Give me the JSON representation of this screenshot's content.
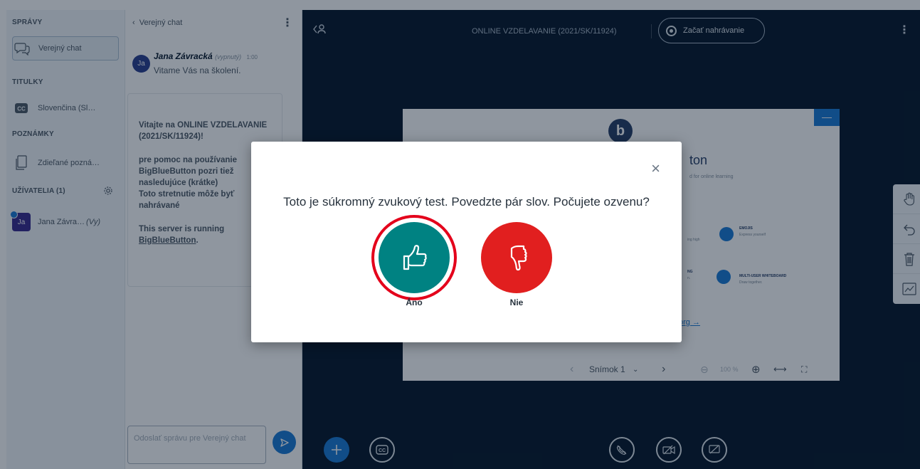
{
  "sidebar": {
    "messages_title": "SPRÁVY",
    "public_chat_label": "Verejný chat",
    "captions_title": "TITULKY",
    "captions_item_label": "Slovenčina (Sl…",
    "notes_title": "POZNÁMKY",
    "notes_item_label": "Zdieľané pozná…",
    "users_title": "UŽÍVATELIA (1)",
    "user_initials": "Ja",
    "user_name": "Jana Závra…",
    "user_you": "(Vy)"
  },
  "chat": {
    "title": "Verejný chat",
    "author_initials": "Ja",
    "author": "Jana Závracká",
    "author_status": "(vypnutý)",
    "time": "1:00",
    "first_message": "Vitame Vás na školení.",
    "welcome_line1": "Vitajte na ",
    "welcome_bold": "ONLINE VZDELAVANIE (2021/SK/11924)",
    "welcome_line1_end": "!",
    "welcome_p2": "pre pomoc na používanie BigBlueButton pozri tiež nasledujúce (krátke)",
    "welcome_p2b": "Toto stretnutie môže byť nahrávané",
    "welcome_p3": "This server is running ",
    "welcome_p3_link": "BigBlueButton",
    "welcome_p3_end": ".",
    "input_placeholder": "Odoslať správu pre Verejný chat"
  },
  "main": {
    "meeting_title": "ONLINE VZDELAVANIE (2021/SK/11924)",
    "record_label": "Začať nahrávanie",
    "slide_title_fragment": "ton",
    "slide_subtitle_fragment": "d for online learning",
    "feature_emojis_title": "EMOJIS",
    "feature_emojis_text": "Express yourself",
    "feature_whiteboard_title": "MULTI-USER WHITEBOARD",
    "feature_whiteboard_text": "Draw together.",
    "feature_left_frag1": "ing high",
    "feature_left_frag2": "NG",
    "feature_left_frag3": "n.",
    "slide_link_fragment": "org →",
    "slide_label": "Snímok 1",
    "zoom": "100 %",
    "minimize": "—"
  },
  "modal": {
    "question": "Toto je súkromný zvukový test. Povedzte pár slov. Počujete ozvenu?",
    "yes_label": "Áno",
    "no_label": "Nie",
    "close": "×"
  },
  "colors": {
    "background": "#06172a",
    "primary": "#1b7ad6",
    "yes": "#008282",
    "no": "#e11f1f",
    "highlight_ring": "#e4001b"
  }
}
